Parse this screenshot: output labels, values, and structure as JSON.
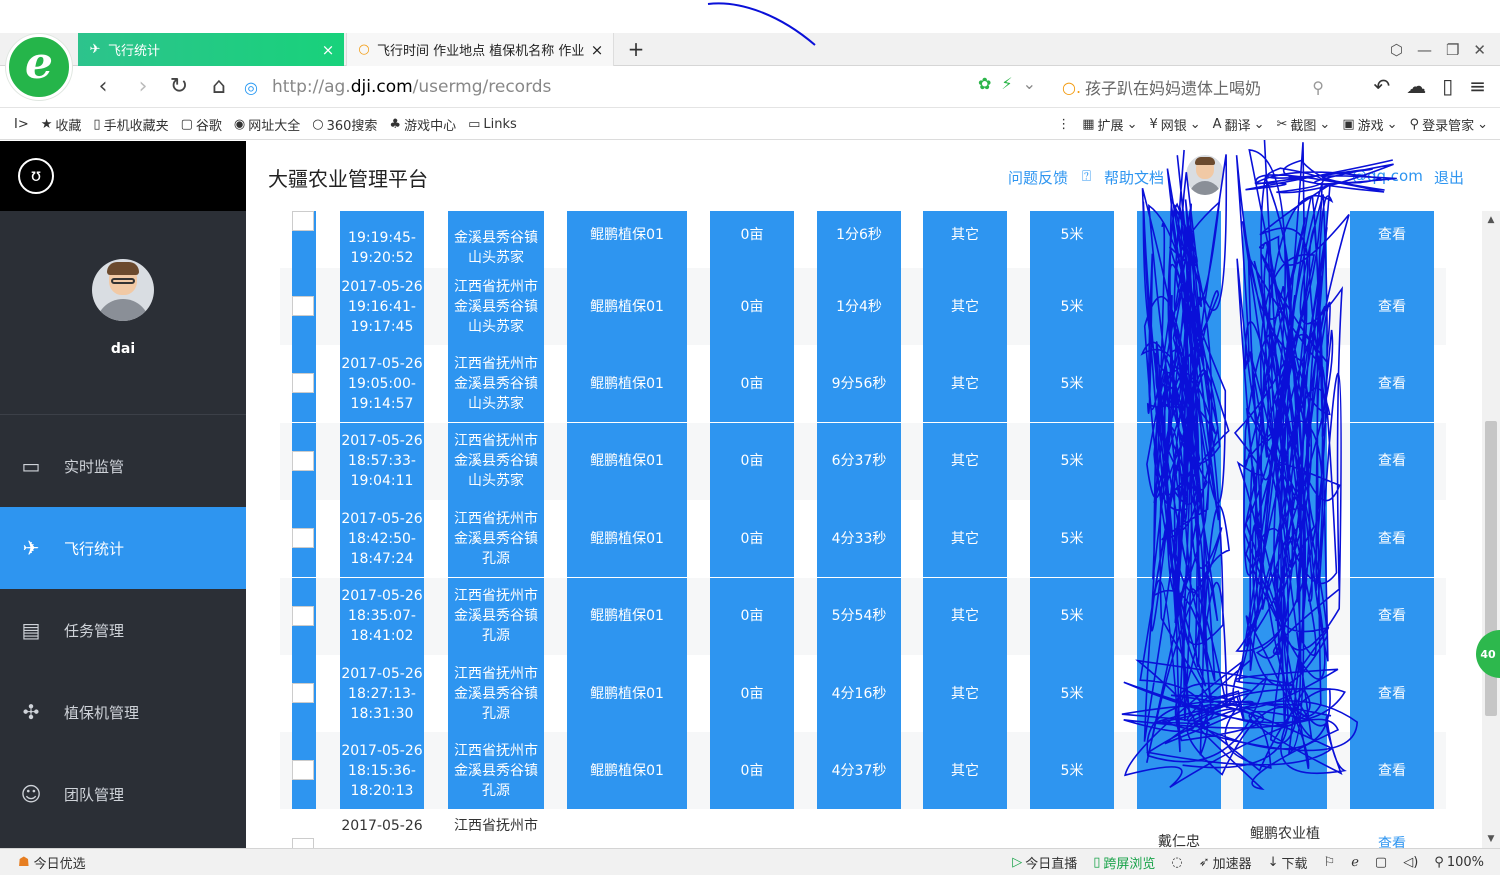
{
  "browser": {
    "tabs": [
      {
        "title": "飞行统计",
        "icon": "dji-icon",
        "close": "×"
      },
      {
        "title": "飞行时间 作业地点 植保机名称 作业",
        "icon": "search-icon",
        "close": "×"
      }
    ],
    "new_tab": "+",
    "address": {
      "prefix": "http://ag.",
      "domain": "dji.com",
      "path": "/usermg/records"
    },
    "search_text": "孩子趴在妈妈遗体上喝奶",
    "bookmarks_left": [
      {
        "label": "收藏",
        "icon": "★"
      },
      {
        "label": "手机收藏夹",
        "icon": "▯"
      },
      {
        "label": "谷歌",
        "icon": "▢"
      },
      {
        "label": "网址大全",
        "icon": "◉"
      },
      {
        "label": "360搜索",
        "icon": "○"
      },
      {
        "label": "游戏中心",
        "icon": "♣"
      },
      {
        "label": "Links",
        "icon": "▭"
      }
    ],
    "bookmarks_right": [
      {
        "label": "扩展",
        "icon": "▦"
      },
      {
        "label": "网银",
        "icon": "¥"
      },
      {
        "label": "翻译",
        "icon": "A"
      },
      {
        "label": "截图",
        "icon": "✂"
      },
      {
        "label": "游戏",
        "icon": "▣"
      },
      {
        "label": "登录管家",
        "icon": "⚲"
      }
    ]
  },
  "sidebar": {
    "username": "dai",
    "items": [
      {
        "label": "实时监管",
        "icon": "▭",
        "active": false
      },
      {
        "label": "飞行统计",
        "icon": "✈",
        "active": true
      },
      {
        "label": "任务管理",
        "icon": "▤",
        "active": false
      },
      {
        "label": "植保机管理",
        "icon": "✣",
        "active": false
      },
      {
        "label": "团队管理",
        "icon": "☺",
        "active": false
      }
    ]
  },
  "header": {
    "title": "大疆农业管理平台",
    "feedback": "问题反馈",
    "help": "帮助文档",
    "email_suffix": "@qq.com",
    "logout": "退出"
  },
  "table": {
    "partial_top": {
      "time_end": "19:20:52",
      "time_start": "19:19:45-",
      "loc": "山头苏家",
      "loc_mid": "金溪县秀谷镇",
      "drone": "鲲鹏植保01",
      "area": "0亩",
      "duration": "1分6秒",
      "crop": "其它",
      "height": "5米",
      "action": "查看"
    },
    "rows": [
      {
        "date": "2017-05-26",
        "start": "19:16:41-",
        "end": "19:17:45",
        "loc1": "江西省抚州市",
        "loc2": "金溪县秀谷镇",
        "loc3": "山头苏家",
        "drone": "鲲鹏植保01",
        "area": "0亩",
        "duration": "1分4秒",
        "crop": "其它",
        "height": "5米",
        "action": "查看"
      },
      {
        "date": "2017-05-26",
        "start": "19:05:00-",
        "end": "19:14:57",
        "loc1": "江西省抚州市",
        "loc2": "金溪县秀谷镇",
        "loc3": "山头苏家",
        "drone": "鲲鹏植保01",
        "area": "0亩",
        "duration": "9分56秒",
        "crop": "其它",
        "height": "5米",
        "action": "查看"
      },
      {
        "date": "2017-05-26",
        "start": "18:57:33-",
        "end": "19:04:11",
        "loc1": "江西省抚州市",
        "loc2": "金溪县秀谷镇",
        "loc3": "山头苏家",
        "drone": "鲲鹏植保01",
        "area": "0亩",
        "duration": "6分37秒",
        "crop": "其它",
        "height": "5米",
        "action": "查看"
      },
      {
        "date": "2017-05-26",
        "start": "18:42:50-",
        "end": "18:47:24",
        "loc1": "江西省抚州市",
        "loc2": "金溪县秀谷镇",
        "loc3": "孔源",
        "drone": "鲲鹏植保01",
        "area": "0亩",
        "duration": "4分33秒",
        "crop": "其它",
        "height": "5米",
        "action": "查看"
      },
      {
        "date": "2017-05-26",
        "start": "18:35:07-",
        "end": "18:41:02",
        "loc1": "江西省抚州市",
        "loc2": "金溪县秀谷镇",
        "loc3": "孔源",
        "drone": "鲲鹏植保01",
        "area": "0亩",
        "duration": "5分54秒",
        "crop": "其它",
        "height": "5米",
        "action": "查看"
      },
      {
        "date": "2017-05-26",
        "start": "18:27:13-",
        "end": "18:31:30",
        "loc1": "江西省抚州市",
        "loc2": "金溪县秀谷镇",
        "loc3": "孔源",
        "drone": "鲲鹏植保01",
        "area": "0亩",
        "duration": "4分16秒",
        "crop": "其它",
        "height": "5米",
        "action": "查看"
      },
      {
        "date": "2017-05-26",
        "start": "18:15:36-",
        "end": "18:20:13",
        "loc1": "江西省抚州市",
        "loc2": "金溪县秀谷镇",
        "loc3": "孔源",
        "drone": "鲲鹏植保01",
        "area": "0亩",
        "duration": "4分37秒",
        "crop": "其它",
        "height": "5米",
        "action": "查看"
      }
    ],
    "partial_bottom": {
      "date": "2017-05-26",
      "loc1": "江西省抚州市",
      "pilot": "戴仁忠",
      "team": "鲲鹏农业植",
      "action": "查看"
    }
  },
  "float_badge": "40",
  "statusbar": {
    "left": "今日优选",
    "items": [
      "今日直播",
      "跨屏浏览",
      "加速器",
      "下载"
    ],
    "zoom": "100%"
  },
  "colors": {
    "accent": "#2e95f0",
    "sidebar": "#2b2f36",
    "scribble": "#0a10d8"
  }
}
